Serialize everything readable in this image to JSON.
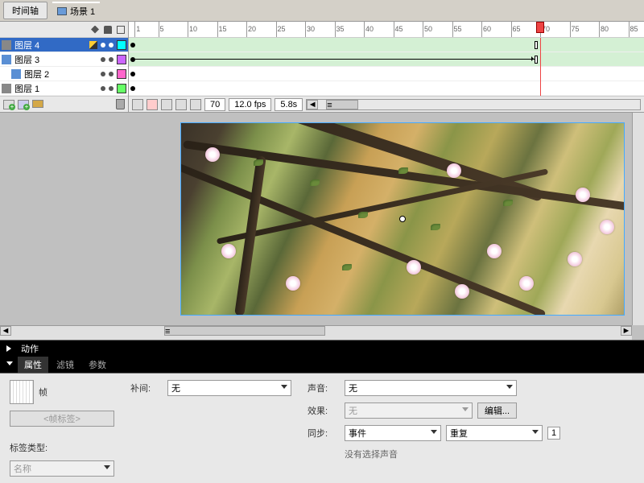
{
  "tabs": {
    "timeline": "时间轴",
    "scene": "场景 1"
  },
  "layers": [
    {
      "name": "图层 4",
      "color": "#00ffff",
      "selected": true,
      "icon": "layer"
    },
    {
      "name": "图层 3",
      "color": "#cc66ff",
      "selected": false,
      "icon": "mask"
    },
    {
      "name": "图层 2",
      "color": "#ff66cc",
      "selected": false,
      "icon": "child"
    },
    {
      "name": "图层 1",
      "color": "#66ff66",
      "selected": false,
      "icon": "layer"
    }
  ],
  "ruler": {
    "start": 1,
    "end": 85,
    "step": 5,
    "playhead": 70
  },
  "track_footer": {
    "frame": "70",
    "fps": "12.0 fps",
    "time": "5.8s"
  },
  "actions_tab": "动作",
  "bottom_tabs": [
    "属性",
    "滤镜",
    "参数"
  ],
  "props": {
    "frame_label": "帧",
    "placeholder": "<帧标签>",
    "label_type": "标签类型:",
    "label_type_val": "名称",
    "tween": "补间:",
    "tween_val": "无",
    "sound": "声音:",
    "sound_val": "无",
    "effect": "效果:",
    "effect_val": "无",
    "edit_btn": "编辑...",
    "sync": "同步:",
    "sync_val": "事件",
    "repeat_val": "重复",
    "repeat_count": "1",
    "no_sound": "没有选择声音"
  }
}
